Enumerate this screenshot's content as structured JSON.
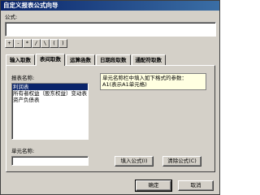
{
  "window": {
    "title": "自定义报表公式向导"
  },
  "formula": {
    "label": "公式:",
    "value": ""
  },
  "operators": [
    "+",
    "-",
    "*",
    "/",
    "\\",
    "(",
    ")"
  ],
  "tabs": [
    {
      "label": "输入取数",
      "active": false
    },
    {
      "label": "表间取数",
      "active": true
    },
    {
      "label": "运算函数",
      "active": false
    },
    {
      "label": "日期段取数",
      "active": false
    },
    {
      "label": "通配符取数",
      "active": false
    }
  ],
  "report_list": {
    "label": "报表名称:",
    "items": [
      {
        "text": "利润表",
        "selected": true
      },
      {
        "text": "所有者权益（股东权益）变动表",
        "selected": false
      },
      {
        "text": "资产负债表",
        "selected": false
      }
    ]
  },
  "hint": {
    "line1": "单元名称栏中填入如下格式的参数：",
    "line2": "A1(表示A1单元格)"
  },
  "cell_name": {
    "label": "单元名称:",
    "value": ""
  },
  "buttons": {
    "fill_formula": "填入公式(I)",
    "clear_formula": "清除公式(C)",
    "ok": "确定",
    "cancel": "取消"
  }
}
